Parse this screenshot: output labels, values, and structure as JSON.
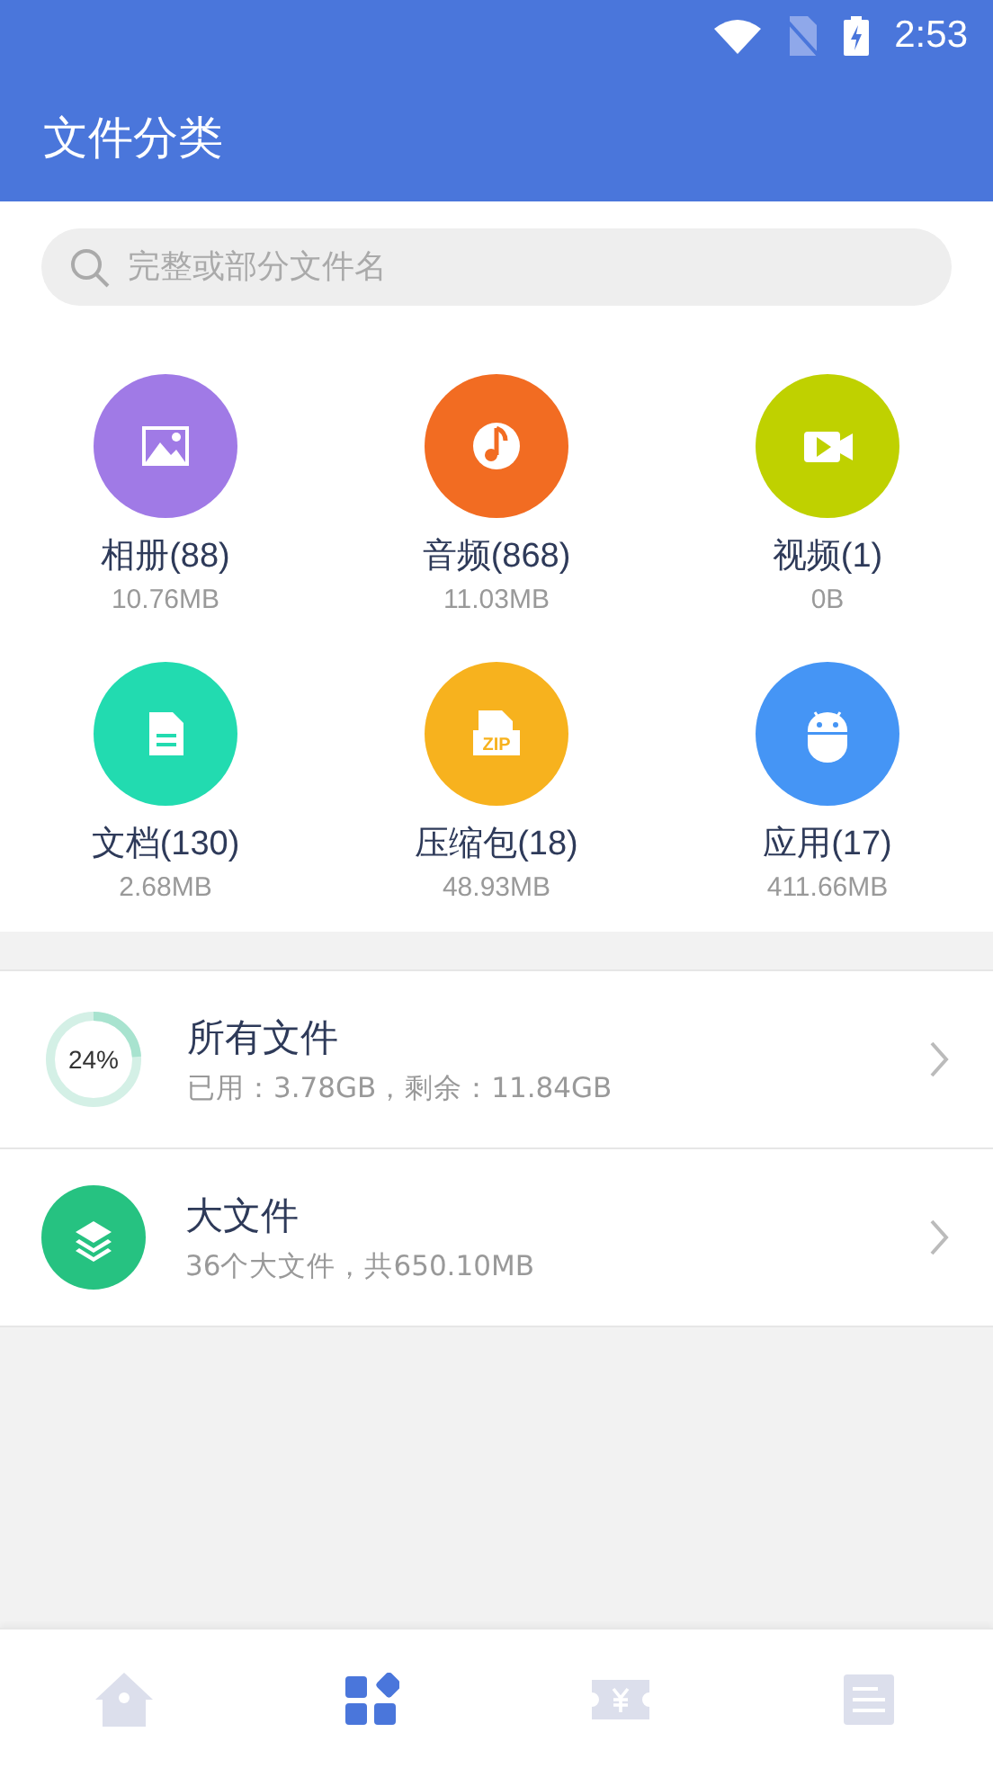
{
  "status_bar": {
    "time": "2:53"
  },
  "app_bar": {
    "title": "文件分类"
  },
  "search": {
    "placeholder": "完整或部分文件名"
  },
  "categories": [
    {
      "kind": "image",
      "name": "相册(88)",
      "size": "10.76MB",
      "color": "#a07ae6"
    },
    {
      "kind": "music",
      "name": "音频(868)",
      "size": "11.03MB",
      "color": "#f26c22"
    },
    {
      "kind": "video",
      "name": "视频(1)",
      "size": "0B",
      "color": "#bfd100"
    },
    {
      "kind": "doc",
      "name": "文档(130)",
      "size": "2.68MB",
      "color": "#22dbb0"
    },
    {
      "kind": "zip",
      "name": "压缩包(18)",
      "size": "48.93MB",
      "color": "#f7b21e",
      "icon_label": "ZIP"
    },
    {
      "kind": "app",
      "name": "应用(17)",
      "size": "411.66MB",
      "color": "#4595f5"
    }
  ],
  "list": [
    {
      "kind": "storage",
      "title": "所有文件",
      "subtitle": "已用：3.78GB，剩余：11.84GB",
      "percent": "24%",
      "level": 0.24
    },
    {
      "kind": "large",
      "title": "大文件",
      "subtitle": "36个大文件，共650.10MB"
    }
  ],
  "bottom_nav": [
    {
      "kind": "home",
      "selected": false
    },
    {
      "kind": "categories",
      "selected": true
    },
    {
      "kind": "ticket",
      "selected": false
    },
    {
      "kind": "list",
      "selected": false
    }
  ]
}
